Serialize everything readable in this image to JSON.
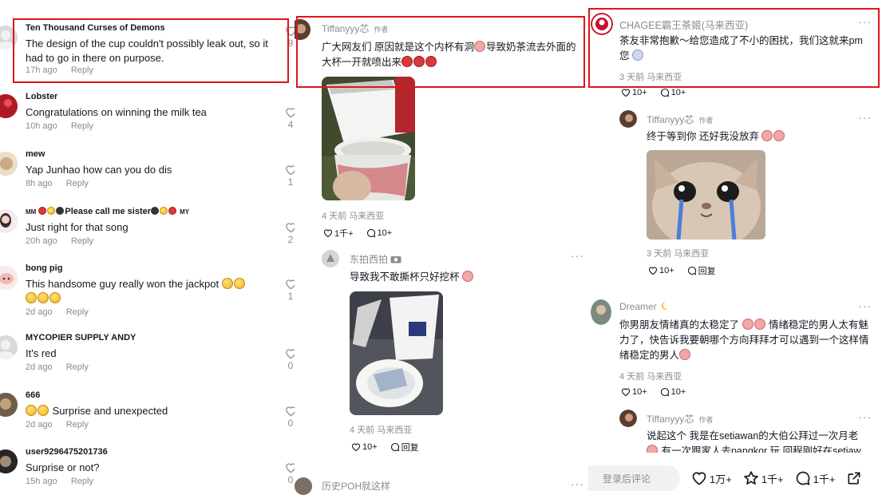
{
  "panel1": {
    "reply_label": "Reply",
    "comments": [
      {
        "user": "Ten Thousand Curses of Demons",
        "text": "The design of the cup couldn't possibly leak out, so it had to go in there on purpose.",
        "time": "17h ago",
        "likes": "9"
      },
      {
        "user": "Lobster",
        "text": "Congratulations on winning the milk tea",
        "time": "10h ago",
        "likes": "4"
      },
      {
        "user": "mew",
        "text": "Yap Junhao how can you do dis",
        "time": "8h ago",
        "likes": "1"
      },
      {
        "user": "Please call me sister",
        "user_suffix": "MY",
        "text": "Just right for that song",
        "time": "20h ago",
        "likes": "2"
      },
      {
        "user": "bong pig",
        "text": "This handsome guy really won the jackpot",
        "time": "2d ago",
        "likes": "1"
      },
      {
        "user": "MYCOPIER SUPPLY ANDY",
        "text": "It's red",
        "time": "2d ago",
        "likes": "0"
      },
      {
        "user": "666",
        "text": "Surprise and unexpected",
        "time": "2d ago",
        "likes": "0"
      },
      {
        "user": "user9296475201736",
        "text": "Surprise or not?",
        "time": "15h ago",
        "likes": "0"
      }
    ]
  },
  "panel2": {
    "main": {
      "user": "Tiffanyyy芯",
      "badge": "作者",
      "text": "广大网友们 原因就是这个内杯有洞",
      "text2": "导致奶茶流去外面的大杯一开就喷出来",
      "date_loc": "4 天前  马来西亚",
      "likes": "1千+",
      "replies": "10+"
    },
    "second": {
      "user": "东拍西拍",
      "text": "导致我不敢撕杯只好挖杯",
      "date_loc": "4 天前  马来西亚",
      "likes": "10+",
      "reply_label": "回复"
    },
    "third": {
      "user": "历史POH就这样"
    }
  },
  "panel3": {
    "brand": {
      "user": "CHAGEE霸王茶姬(马来西亚)",
      "text": "茶友非常抱歉～给您造成了不小的困扰，我们这就来pm 您",
      "date_loc": "3 天前  马来西亚",
      "likes": "10+",
      "replies": "10+"
    },
    "author_reply": {
      "user": "Tiffanyyy芯",
      "badge": "作者",
      "text": "终于等到你 还好我没放弃",
      "date_loc": "3 天前  马来西亚",
      "likes": "10+",
      "reply_label": "回复"
    },
    "dreamer": {
      "user": "Dreamer",
      "text": "你男朋友情绪真的太稳定了",
      "text2": "情绪稳定的男人太有魅力了，快告诉我要朝哪个方向拜拜才可以遇到一个这样情绪稳定的男人",
      "date_loc": "4 天前  马来西亚",
      "likes": "10+",
      "replies": "10+"
    },
    "author_reply2": {
      "user": "Tiffanyyy芯",
      "badge": "作者",
      "text": "说起这个 我是在setiawan的大伯公拜过一次月老",
      "text2": "有一次跟家人去pangkor 玩 回程刚好在setiaw"
    },
    "bottom_bar": {
      "placeholder": "登录后评论",
      "likes": "1万+",
      "favorites": "1千+",
      "comments": "1千+"
    }
  },
  "colors": {
    "highlight_box": "#e0141b",
    "muted_text": "#8a8b91"
  }
}
